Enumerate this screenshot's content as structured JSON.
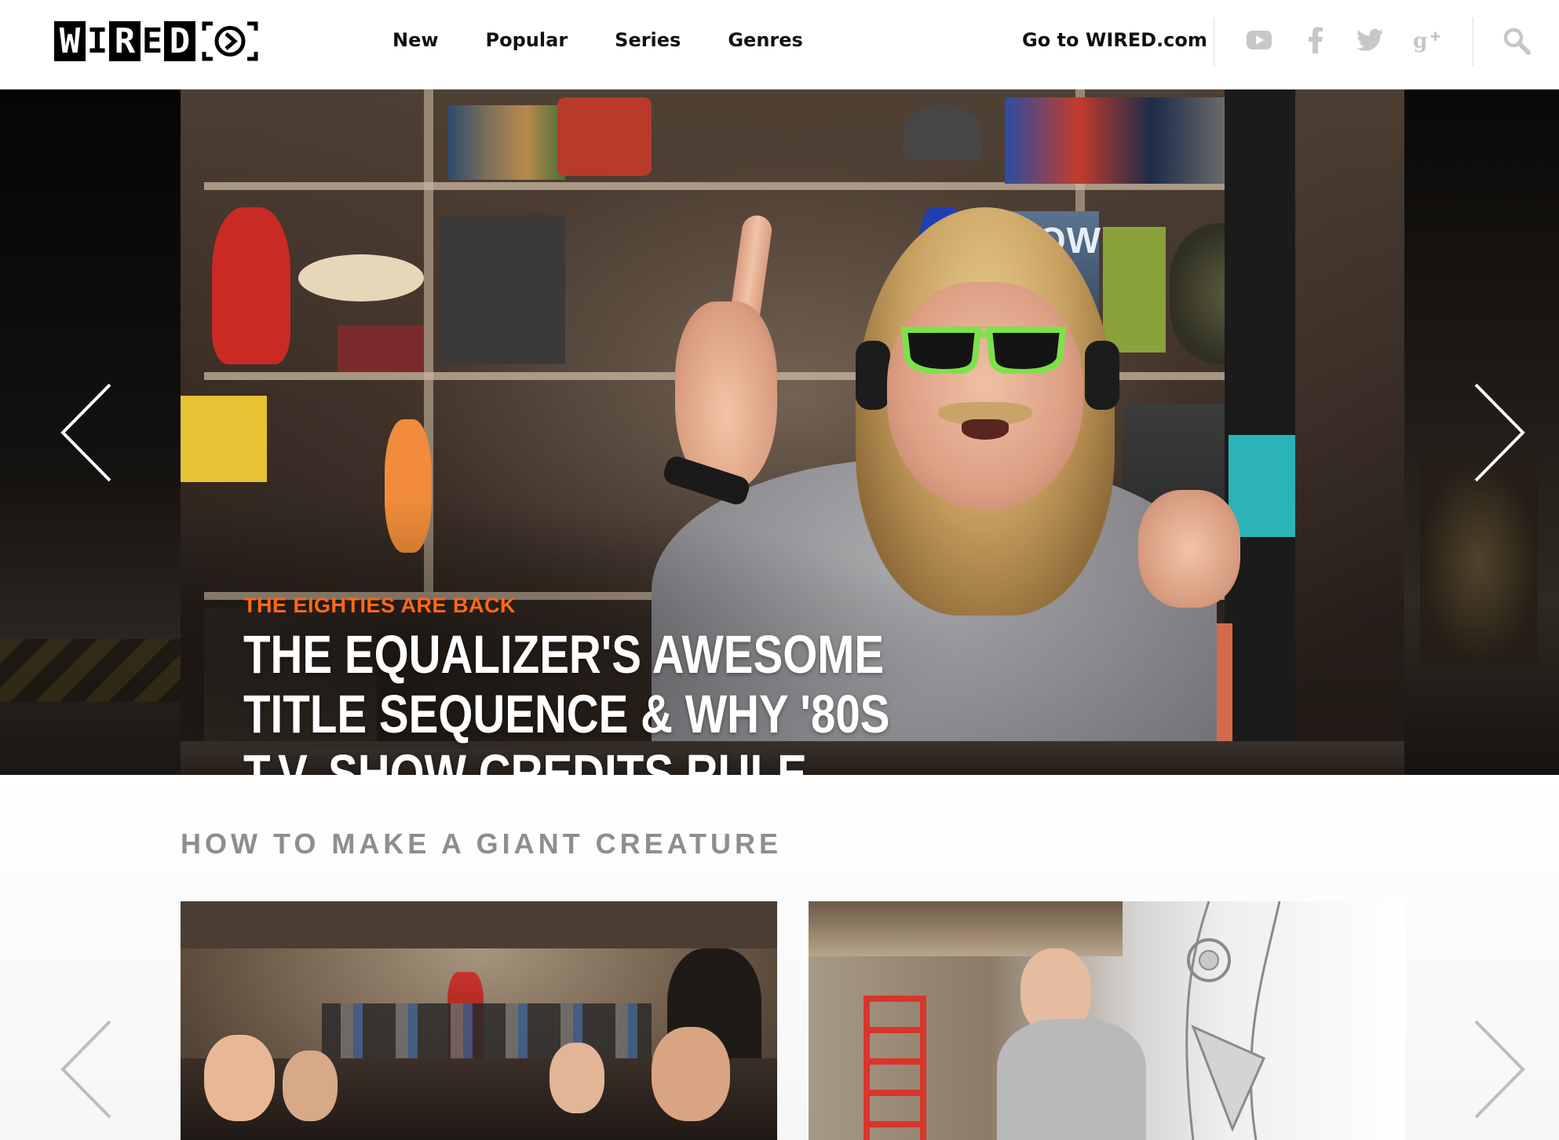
{
  "header": {
    "logo_letters": [
      "W",
      "I",
      "R",
      "E",
      "D"
    ],
    "nav": [
      "New",
      "Popular",
      "Series",
      "Genres"
    ],
    "goto_label": "Go to WIRED.com",
    "social_icons": [
      "youtube-icon",
      "facebook-icon",
      "twitter-icon",
      "google-plus-icon"
    ],
    "search_icon": "search-icon"
  },
  "hero": {
    "kicker": "THE EIGHTIES ARE BACK",
    "title_lines": [
      "THE EQUALIZER'S AWESOME",
      "TITLE SEQUENCE & WHY '80S",
      "T.V. SHOW CREDITS RULE."
    ],
    "prev_icon": "chevron-left-icon",
    "next_icon": "chevron-right-icon",
    "accent_color": "#ff6a13",
    "shelf_sign_text": "SNOW"
  },
  "section": {
    "title": "HOW TO MAKE A GIANT CREATURE",
    "prev_icon": "chevron-left-icon",
    "next_icon": "chevron-right-icon"
  }
}
